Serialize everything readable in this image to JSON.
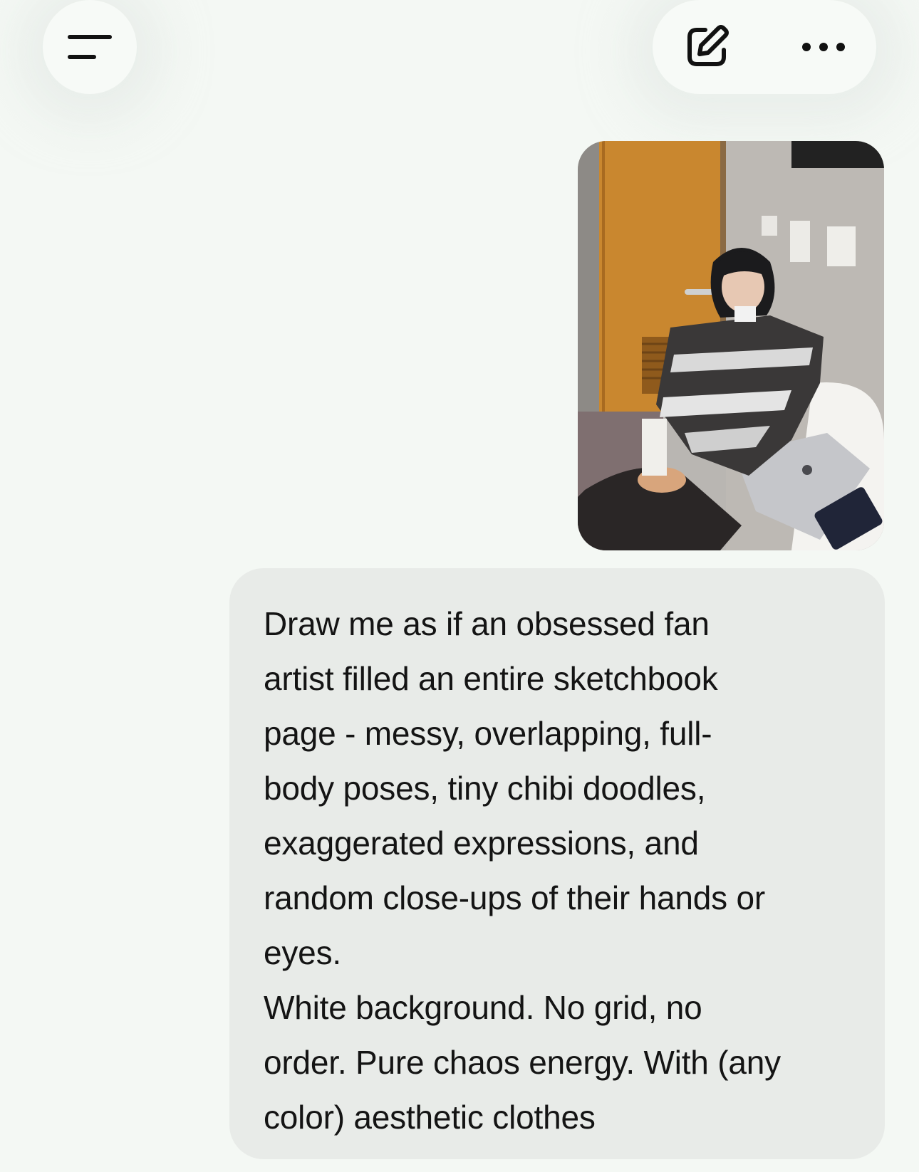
{
  "header": {
    "menu_icon": "hamburger-menu-icon",
    "edit_icon": "new-chat-edit-icon",
    "more_icon": "more-horizontal-icon"
  },
  "attachment": {
    "type": "photo",
    "description_icon": "image-attachment"
  },
  "message": {
    "text": "Draw me as if an obsessed fan\nartist filled an entire sketchbook\npage - messy, overlapping, full-\nbody poses, tiny chibi doodles,\nexaggerated expressions, and\nrandom close-ups of their hands or\neyes.\nWhite background. No grid, no\norder. Pure chaos energy. With (any\ncolor) aesthetic clothes"
  },
  "colors": {
    "background": "#f4f8f4",
    "bubble": "#e8ebe8",
    "text": "#141414",
    "icon": "#111111"
  }
}
